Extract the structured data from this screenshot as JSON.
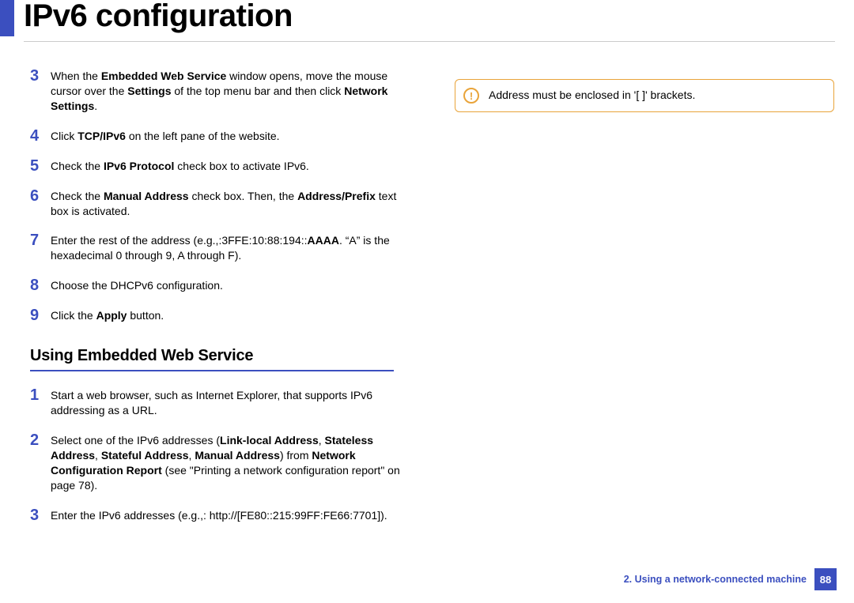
{
  "title": "IPv6 configuration",
  "stepsA": [
    {
      "num": "3",
      "html": "When the <b>Embedded Web Service</b> window opens, move the mouse cursor over the <b>Settings</b> of the top menu bar and then click <b>Network Settings</b>."
    },
    {
      "num": "4",
      "html": "Click <b>TCP/IPv6</b> on the left pane of the website."
    },
    {
      "num": "5",
      "html": "Check the <b>IPv6 Protocol</b> check box to activate IPv6."
    },
    {
      "num": "6",
      "html": "Check the <b>Manual Address</b> check box. Then, the <b>Address/Prefix</b> text box is activated."
    },
    {
      "num": "7",
      "html": "Enter the rest of the address (e.g.,:3FFE:10:88:194::<b>AAAA</b>. “A” is the hexadecimal 0 through 9, A through F)."
    },
    {
      "num": "8",
      "html": "Choose the DHCPv6 configuration."
    },
    {
      "num": "9",
      "html": "Click the <b>Apply</b> button."
    }
  ],
  "sectionHeading": "Using Embedded Web Service",
  "stepsB": [
    {
      "num": "1",
      "html": "Start a web browser, such as Internet Explorer, that supports IPv6 addressing as a URL."
    },
    {
      "num": "2",
      "html": "Select one of the IPv6 addresses (<b>Link-local Address</b>, <b>Stateless Address</b>, <b>Stateful Address</b>, <b>Manual Address</b>) from <b>Network Configuration Report</b> (see \"Printing a network configuration report\" on page 78)."
    },
    {
      "num": "3",
      "html": "Enter the IPv6 addresses (e.g.,: http://[FE80::215:99FF:FE66:7701])."
    }
  ],
  "callout": {
    "iconChar": "!",
    "text": "Address must be enclosed in '[ ]' brackets."
  },
  "footer": {
    "chapter": "2.  Using a network-connected machine",
    "page": "88"
  }
}
